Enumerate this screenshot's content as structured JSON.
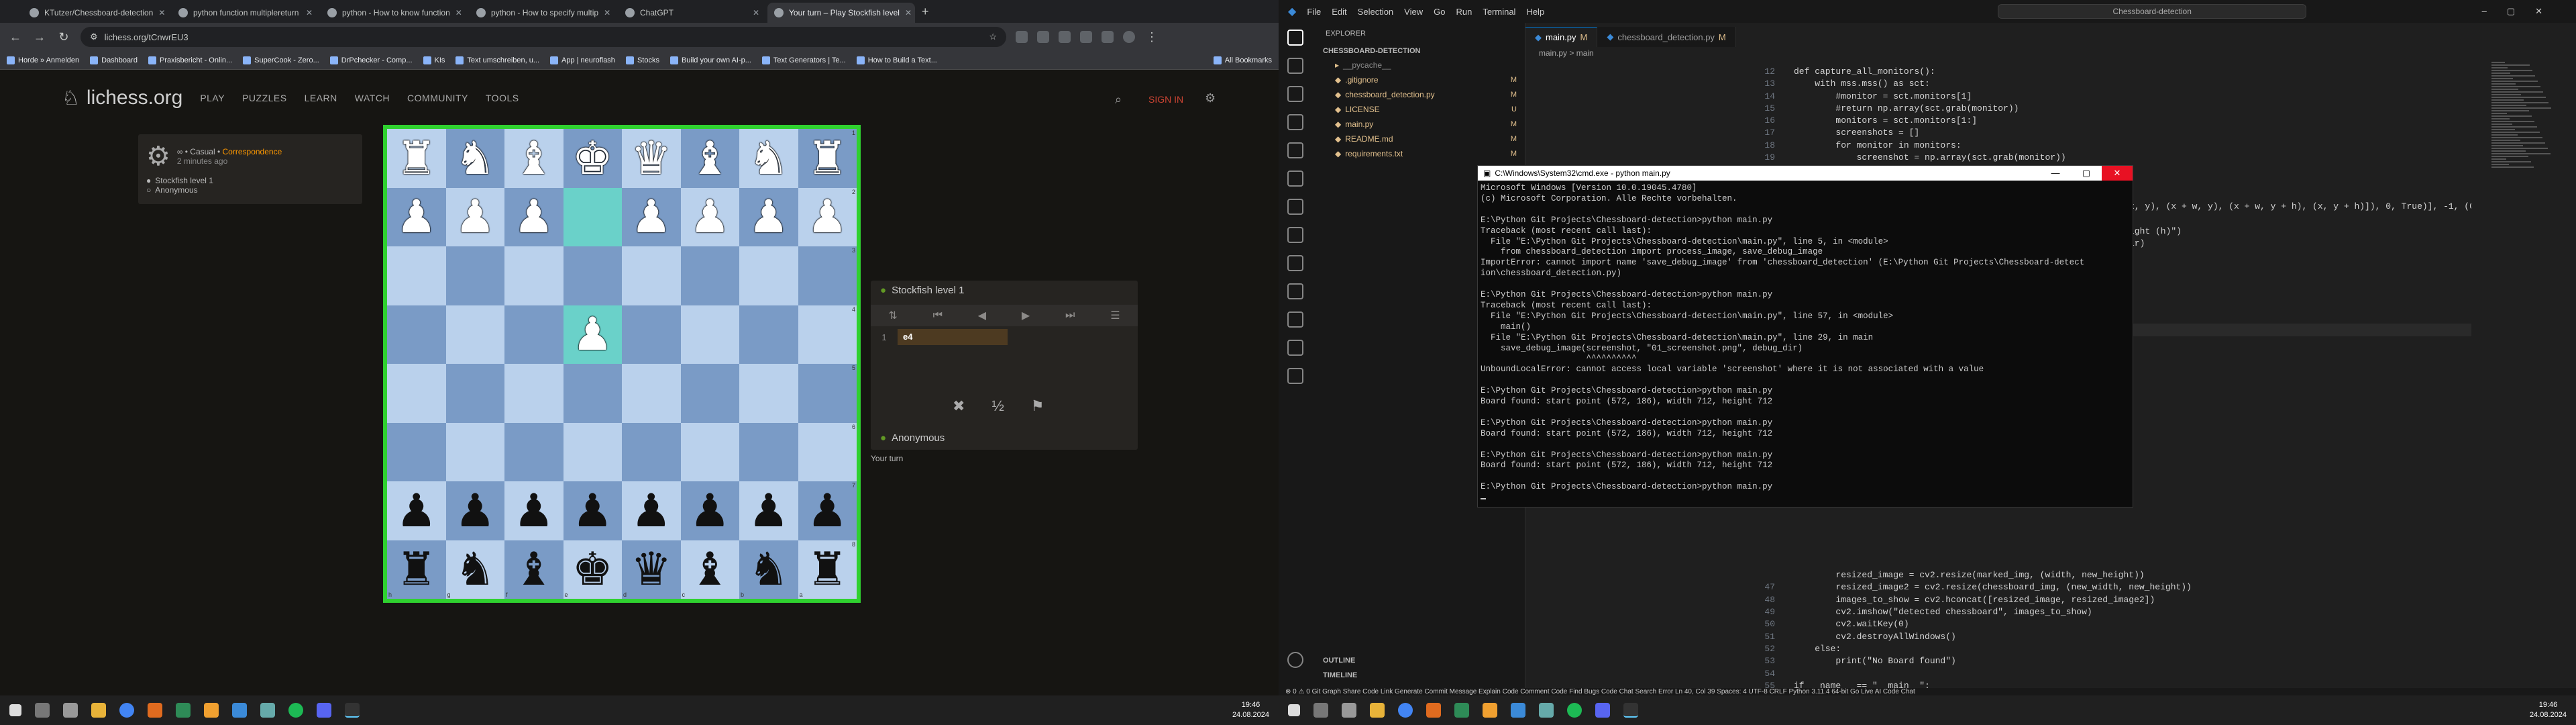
{
  "chrome": {
    "tabs": [
      {
        "label": "KTutzer/Chessboard-detection"
      },
      {
        "label": "python function multiplereturn"
      },
      {
        "label": "python - How to know function"
      },
      {
        "label": "python - How to specify multip"
      },
      {
        "label": "ChatGPT"
      },
      {
        "label": "Your turn – Play Stockfish level"
      }
    ],
    "url": "lichess.org/tCnwrEU3",
    "bookmarks": [
      "Horde » Anmelden",
      "Dashboard",
      "Praxisbericht - Onlin...",
      "SuperCook - Zero...",
      "DrPchecker - Comp...",
      "KIs",
      "Text umschreiben, u...",
      "App | neuroflash",
      "Stocks",
      "Build your own AI-p...",
      "Text Generators | Te...",
      "How to Build a Text...",
      "All Bookmarks"
    ]
  },
  "lichess": {
    "logo": "lichess.org",
    "nav": [
      "PLAY",
      "PUZZLES",
      "LEARN",
      "WATCH",
      "COMMUNITY",
      "TOOLS"
    ],
    "signin": "SIGN IN",
    "game": {
      "type": "∞ • Casual •",
      "mode": "Correspondence",
      "time": "2 minutes ago",
      "white": "Stockfish level 1",
      "black": "Anonymous"
    },
    "board_fen": [
      [
        "♜",
        "♞",
        "♝",
        "♚",
        "♛",
        "♝",
        "♞",
        "♜"
      ],
      [
        "♟",
        "♟",
        "♟",
        "",
        "♟",
        "♟",
        "♟",
        "♟"
      ],
      [
        "",
        "",
        "",
        "",
        "",
        "",
        "",
        ""
      ],
      [
        "",
        "",
        "",
        "♟",
        "",
        "",
        "",
        ""
      ],
      [
        "",
        "",
        "",
        "",
        "",
        "",
        "",
        ""
      ],
      [
        "",
        "",
        "",
        "",
        "",
        "",
        "",
        ""
      ],
      [
        "♟",
        "♟",
        "♟",
        "♟",
        "♟",
        "♟",
        "♟",
        "♟"
      ],
      [
        "♜",
        "♞",
        "♝",
        "♚",
        "♛",
        "♝",
        "♞",
        "♜"
      ]
    ],
    "files": [
      "h",
      "g",
      "f",
      "e",
      "d",
      "c",
      "b",
      "a"
    ],
    "ranks": [
      "1",
      "2",
      "3",
      "4",
      "5",
      "6",
      "7",
      "8"
    ],
    "top_player": "Stockfish level 1",
    "bottom_player": "Anonymous",
    "moves": [
      {
        "num": "1",
        "white": "e4"
      }
    ],
    "your_turn": "Your turn",
    "half": "½"
  },
  "taskbar": {
    "time": "19:46",
    "date": "24.08.2024"
  },
  "vscode": {
    "menu": [
      "File",
      "Edit",
      "Selection",
      "View",
      "Go",
      "Run",
      "Terminal",
      "Help"
    ],
    "search": "Chessboard-detection",
    "explorer_title": "EXPLORER",
    "project": "CHESSBOARD-DETECTION",
    "files": [
      {
        "name": "__pycache__",
        "badge": ""
      },
      {
        "name": ".gitignore",
        "badge": "M"
      },
      {
        "name": "chessboard_detection.py",
        "badge": "M"
      },
      {
        "name": "LICENSE",
        "badge": "U"
      },
      {
        "name": "main.py",
        "badge": "M"
      },
      {
        "name": "README.md",
        "badge": "M"
      },
      {
        "name": "requirements.txt",
        "badge": "M"
      }
    ],
    "outline": "OUTLINE",
    "timeline": "TIMELINE",
    "tabs": [
      {
        "label": "main.py",
        "badge": "M"
      },
      {
        "label": "chessboard_detection.py",
        "badge": "M"
      }
    ],
    "breadcrumb": "main.py  >  main",
    "line_numbers": [
      "12",
      "13",
      "14",
      "15",
      "16",
      "17",
      "18",
      "19",
      "20",
      "",
      "",
      "",
      "",
      "",
      "",
      "",
      "",
      "",
      "",
      "",
      "",
      "",
      "",
      "",
      "",
      "",
      "",
      "",
      "",
      "",
      "",
      "",
      "",
      "",
      "",
      "",
      "",
      "",
      "",
      "",
      "",
      "",
      "47",
      "48",
      "49",
      "50",
      "51",
      "52",
      "53",
      "54",
      "55",
      "56"
    ],
    "code_top": [
      "def capture_all_monitors():",
      "    with mss.mss() as sct:",
      "        #monitor = sct.monitors[1]",
      "        #return np.array(sct.grab(monitor))",
      "        monitors = sct.monitors[1:]",
      "        screenshots = []",
      "        for monitor in monitors:",
      "            screenshot = np.array(sct.grab(monitor))"
    ],
    "code_right": [
      "x, y), (x + w, y), (x + w, y + h), (x, y + h)]), 0, True)], -1, (0,",
      "ight (h)\")",
      "ir)"
    ],
    "code_bottom": [
      "        resized_image = cv2.resize(marked_img, (width, new_height))",
      "        resized_image2 = cv2.resize(chessboard_img, (new_width, new_height))",
      "        images_to_show = cv2.hconcat([resized_image, resized_image2])",
      "        cv2.imshow(\"detected chessboard\", images_to_show)",
      "        cv2.waitKey(0)",
      "        cv2.destroyAllWindows()",
      "    else:",
      "        print(\"No Board found\")",
      "",
      "if __name__ == \"__main__\":",
      "    main()"
    ],
    "status": "⊗ 0 ⚠ 0    Git Graph    Share Code Link    Generate Commit Message    Explain Code    Comment Code    Find Bugs    Code Chat    Search Error                    Ln 40, Col 39    Spaces: 4    UTF-8    CRLF    Python    3.11.4 64-bit    Go Live    AI Code Chat"
  },
  "cmd": {
    "title": "C:\\Windows\\System32\\cmd.exe - python  main.py",
    "lines": [
      "Microsoft Windows [Version 10.0.19045.4780]",
      "(c) Microsoft Corporation. Alle Rechte vorbehalten.",
      "",
      "E:\\Python Git Projects\\Chessboard-detection>python main.py",
      "Traceback (most recent call last):",
      "  File \"E:\\Python Git Projects\\Chessboard-detection\\main.py\", line 5, in <module>",
      "    from chessboard_detection import process_image, save_debug_image",
      "ImportError: cannot import name 'save_debug_image' from 'chessboard_detection' (E:\\Python Git Projects\\Chessboard-detect",
      "ion\\chessboard_detection.py)",
      "",
      "E:\\Python Git Projects\\Chessboard-detection>python main.py",
      "Traceback (most recent call last):",
      "  File \"E:\\Python Git Projects\\Chessboard-detection\\main.py\", line 57, in <module>",
      "    main()",
      "  File \"E:\\Python Git Projects\\Chessboard-detection\\main.py\", line 29, in main",
      "    save_debug_image(screenshot, \"01_screenshot.png\", debug_dir)",
      "                     ^^^^^^^^^^",
      "UnboundLocalError: cannot access local variable 'screenshot' where it is not associated with a value",
      "",
      "E:\\Python Git Projects\\Chessboard-detection>python main.py",
      "Board found: start point (572, 186), width 712, height 712",
      "",
      "E:\\Python Git Projects\\Chessboard-detection>python main.py",
      "Board found: start point (572, 186), width 712, height 712",
      "",
      "E:\\Python Git Projects\\Chessboard-detection>python main.py",
      "Board found: start point (572, 186), width 712, height 712",
      "",
      "E:\\Python Git Projects\\Chessboard-detection>python main.py"
    ]
  },
  "colors": {
    "board_light": "#bad1ec",
    "board_dark": "#7a9bc6",
    "highlight": "#6ad1c9",
    "board_border": "#2fd12f",
    "signin": "#cc4433"
  }
}
